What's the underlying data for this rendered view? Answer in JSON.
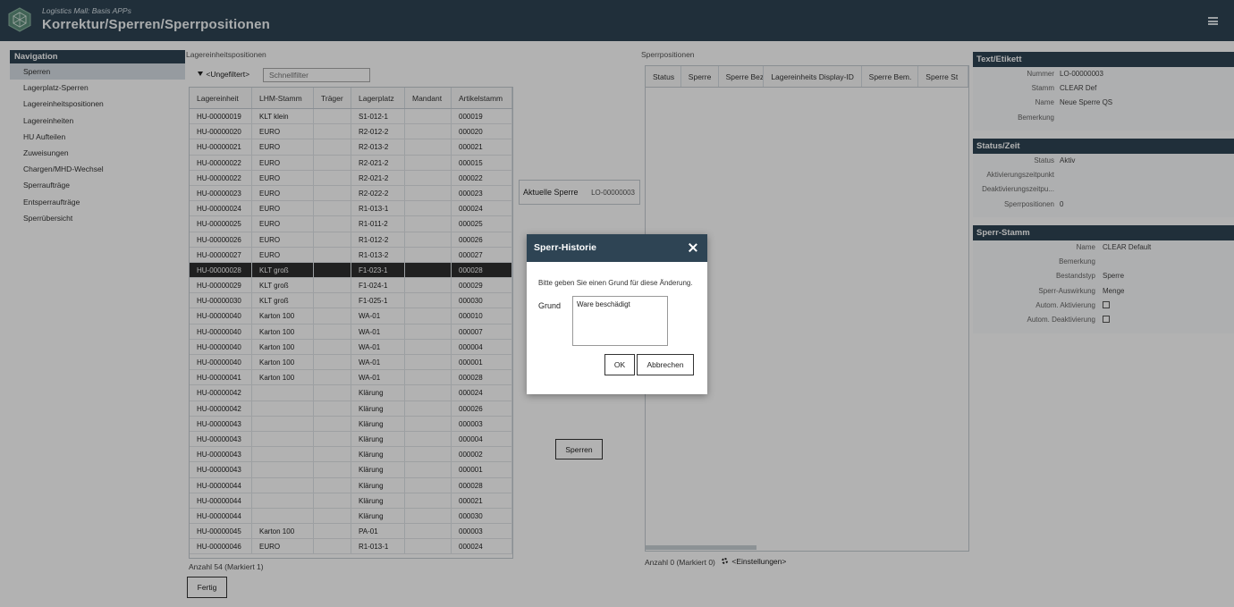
{
  "header": {
    "subtitle": "Logistics Mall: Basis APPs",
    "title": "Korrektur/Sperren/Sperrpositionen"
  },
  "nav": {
    "title": "Navigation",
    "items": [
      {
        "label": "Sperren",
        "active": true
      },
      {
        "label": "Lagerplatz-Sperren"
      },
      {
        "label": "Lagereinheitspositionen"
      },
      {
        "label": "Lagereinheiten"
      },
      {
        "label": "HU Aufteilen"
      },
      {
        "label": "Zuweisungen"
      },
      {
        "label": "Chargen/MHD-Wechsel"
      },
      {
        "label": "Sperraufträge"
      },
      {
        "label": "Entsperraufträge"
      },
      {
        "label": "Sperrübersicht"
      }
    ]
  },
  "left": {
    "section_label": "Lagereinheitspositionen",
    "filter_label": "<Ungefiltert>",
    "quickfilter_placeholder": "Schnellfilter",
    "columns": [
      "Lagereinheit",
      "LHM-Stamm",
      "Träger",
      "Lagerplatz",
      "Mandant",
      "Artikelstamm"
    ],
    "rows": [
      [
        "HU-00000019",
        "KLT klein",
        "",
        "S1-012-1",
        "",
        "000019"
      ],
      [
        "HU-00000020",
        "EURO",
        "",
        "R2-012-2",
        "",
        "000020"
      ],
      [
        "HU-00000021",
        "EURO",
        "",
        "R2-013-2",
        "",
        "000021"
      ],
      [
        "HU-00000022",
        "EURO",
        "",
        "R2-021-2",
        "",
        "000015"
      ],
      [
        "HU-00000022",
        "EURO",
        "",
        "R2-021-2",
        "",
        "000022"
      ],
      [
        "HU-00000023",
        "EURO",
        "",
        "R2-022-2",
        "",
        "000023"
      ],
      [
        "HU-00000024",
        "EURO",
        "",
        "R1-013-1",
        "",
        "000024"
      ],
      [
        "HU-00000025",
        "EURO",
        "",
        "R1-011-2",
        "",
        "000025"
      ],
      [
        "HU-00000026",
        "EURO",
        "",
        "R1-012-2",
        "",
        "000026"
      ],
      [
        "HU-00000027",
        "EURO",
        "",
        "R1-013-2",
        "",
        "000027"
      ],
      [
        "HU-00000028",
        "KLT groß",
        "",
        "F1-023-1",
        "",
        "000028"
      ],
      [
        "HU-00000029",
        "KLT groß",
        "",
        "F1-024-1",
        "",
        "000029"
      ],
      [
        "HU-00000030",
        "KLT groß",
        "",
        "F1-025-1",
        "",
        "000030"
      ],
      [
        "HU-00000040",
        "Karton 100",
        "",
        "WA-01",
        "",
        "000010"
      ],
      [
        "HU-00000040",
        "Karton 100",
        "",
        "WA-01",
        "",
        "000007"
      ],
      [
        "HU-00000040",
        "Karton 100",
        "",
        "WA-01",
        "",
        "000004"
      ],
      [
        "HU-00000040",
        "Karton 100",
        "",
        "WA-01",
        "",
        "000001"
      ],
      [
        "HU-00000041",
        "Karton 100",
        "",
        "WA-01",
        "",
        "000028"
      ],
      [
        "HU-00000042",
        "",
        "",
        "Klärung",
        "",
        "000024"
      ],
      [
        "HU-00000042",
        "",
        "",
        "Klärung",
        "",
        "000026"
      ],
      [
        "HU-00000043",
        "",
        "",
        "Klärung",
        "",
        "000003"
      ],
      [
        "HU-00000043",
        "",
        "",
        "Klärung",
        "",
        "000004"
      ],
      [
        "HU-00000043",
        "",
        "",
        "Klärung",
        "",
        "000002"
      ],
      [
        "HU-00000043",
        "",
        "",
        "Klärung",
        "",
        "000001"
      ],
      [
        "HU-00000044",
        "",
        "",
        "Klärung",
        "",
        "000028"
      ],
      [
        "HU-00000044",
        "",
        "",
        "Klärung",
        "",
        "000021"
      ],
      [
        "HU-00000044",
        "",
        "",
        "Klärung",
        "",
        "000030"
      ],
      [
        "HU-00000045",
        "Karton 100",
        "",
        "PA-01",
        "",
        "000003"
      ],
      [
        "HU-00000046",
        "EURO",
        "",
        "R1-013-1",
        "",
        "000024"
      ]
    ],
    "selected_row": 10,
    "count_label": "Anzahl 54 (Markiert 1)",
    "done_button": "Fertig"
  },
  "middle": {
    "current_label": "Aktuelle Sperre",
    "current_value": "LO-00000003",
    "lock_button": "Sperren"
  },
  "right": {
    "section_label": "Sperrpositionen",
    "columns": [
      "Status",
      "Sperre",
      "Sperre Bez.",
      "Lagereinheits Display-ID",
      "Sperre Bem.",
      "Sperre St"
    ],
    "count_label": "Anzahl 0 (Markiert 0)",
    "settings_label": "<Einstellungen>"
  },
  "panel": {
    "text": {
      "title": "Text/Etikett",
      "fields": [
        {
          "label": "Nummer",
          "value": "LO-00000003"
        },
        {
          "label": "Stamm",
          "value": "CLEAR Def"
        },
        {
          "label": "Name",
          "value": "Neue Sperre QS"
        },
        {
          "label": "Bemerkung",
          "value": ""
        }
      ]
    },
    "status": {
      "title": "Status/Zeit",
      "fields": [
        {
          "label": "Status",
          "value": "Aktiv"
        },
        {
          "label": "Aktivierungszeitpunkt",
          "value": ""
        },
        {
          "label": "Deaktivierungszeitpu...",
          "value": ""
        },
        {
          "label": "Sperrpositionen",
          "value": "0"
        }
      ]
    },
    "stamm": {
      "title": "Sperr-Stamm",
      "fields": [
        {
          "label": "Name",
          "value": "CLEAR Default"
        },
        {
          "label": "Bemerkung",
          "value": ""
        },
        {
          "label": "Bestandstyp",
          "value": "Sperre"
        },
        {
          "label": "Sperr-Auswirkung",
          "value": "Menge"
        },
        {
          "label": "Autom. Aktivierung",
          "value": "",
          "checkbox": true
        },
        {
          "label": "Autom. Deaktivierung",
          "value": "",
          "checkbox": true
        }
      ]
    }
  },
  "dialog": {
    "title": "Sperr-Historie",
    "message": "Bitte geben Sie einen Grund für diese Änderung.",
    "reason_label": "Grund",
    "reason_value": "Ware beschädigt",
    "ok_label": "OK",
    "cancel_label": "Abbrechen"
  },
  "colors": {
    "header_bg": "#2e4454",
    "selected_row": "#2f2f2f"
  }
}
